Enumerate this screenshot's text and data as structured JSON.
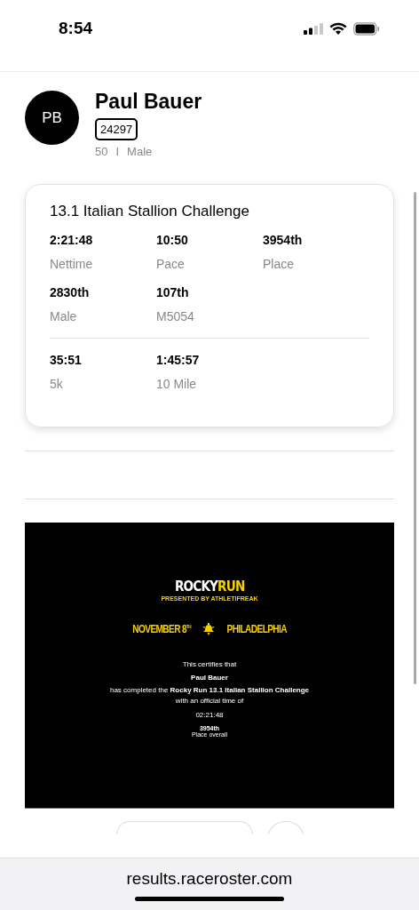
{
  "status_bar": {
    "time": "8:54"
  },
  "athlete": {
    "initials": "PB",
    "name": "Paul Bauer",
    "bib": "24297",
    "age": "50",
    "separator": "I",
    "gender": "Male"
  },
  "result_card": {
    "event": "13.1 Italian Stallion Challenge",
    "stat_rows": [
      [
        {
          "value": "2:21:48",
          "label": "Nettime"
        },
        {
          "value": "10:50",
          "label": "Pace"
        },
        {
          "value": "3954th",
          "label": "Place"
        }
      ],
      [
        {
          "value": "2830th",
          "label": "Male"
        },
        {
          "value": "107th",
          "label": "M5054"
        }
      ]
    ],
    "splits": [
      {
        "value": "35:51",
        "label": "5k"
      },
      {
        "value": "1:45:57",
        "label": "10 Mile"
      }
    ]
  },
  "certificate": {
    "logo_left": "ROCKY",
    "logo_right": "RUN",
    "logo_sub": "PRESENTED BY ATHLETIFREAK",
    "date": "NOVEMBER 8",
    "date_sup": "TH",
    "city": "PHILADELPHIA",
    "lines": [
      "This certifies that",
      "Paul Bauer",
      "has completed the **Rocky Run 13.1 Italian Stallion Challenge**",
      "with an official time of",
      "02:21:48"
    ],
    "place": "3954th",
    "place_label": "Place overall"
  },
  "browser": {
    "url": "results.raceroster.com"
  }
}
